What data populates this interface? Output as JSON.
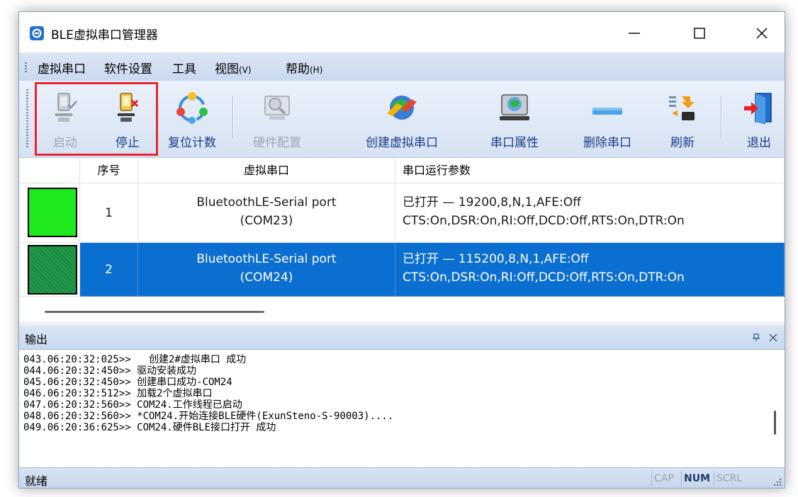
{
  "window": {
    "title": "BLE虚拟串口管理器"
  },
  "menu": {
    "items": [
      {
        "label": "虚拟串口",
        "key": ""
      },
      {
        "label": "软件设置",
        "key": ""
      },
      {
        "label": "工具",
        "key": ""
      },
      {
        "label": "视图",
        "key": "(V)"
      },
      {
        "label": "帮助",
        "key": "(H)"
      }
    ]
  },
  "toolbar": {
    "start": "启动",
    "stop": "停止",
    "reset_count": "复位计数",
    "hw_config": "硬件配置",
    "create_port": "创建虚拟串口",
    "port_props": "串口属性",
    "delete_port": "删除串口",
    "refresh": "刷新",
    "exit": "退出"
  },
  "list": {
    "columns": [
      "序号",
      "虚拟串口",
      "串口运行参数"
    ],
    "rows": [
      {
        "index": "1",
        "port_line1": "BluetoothLE-Serial port",
        "port_line2": "(COM23)",
        "params_line1": "已打开 — 19200,8,N,1,AFE:Off",
        "params_line2": "CTS:On,DSR:On,RI:Off,DCD:Off,RTS:On,DTR:On",
        "selected": false
      },
      {
        "index": "2",
        "port_line1": "BluetoothLE-Serial port",
        "port_line2": "(COM24)",
        "params_line1": "已打开 — 115200,8,N,1,AFE:Off",
        "params_line2": "CTS:On,DSR:On,RI:Off,DCD:Off,RTS:On,DTR:On",
        "selected": true
      }
    ]
  },
  "output": {
    "title": "输出",
    "lines": [
      "043.06:20:32:025>>   创建2#虚拟串口 成功",
      "044.06:20:32:450>> 驱动安装成功",
      "045.06:20:32:450>> 创建串口成功-COM24",
      "046.06:20:32:512>> 加载2个虚拟串口",
      "047.06:20:32:560>> COM24.工作线程已启动",
      "048.06:20:32:560>> *COM24.开始连接BLE硬件(ExunSteno-S-90003)....",
      "049.06:20:36:625>> COM24.硬件BLE接口打开 成功"
    ]
  },
  "status": {
    "text": "就绪",
    "cap": "CAP",
    "num": "NUM",
    "scrl": "SCRL"
  },
  "colors": {
    "selection": "#0a6fd1",
    "online_green": "#1eea1e",
    "highlight_red": "#e8252f"
  }
}
